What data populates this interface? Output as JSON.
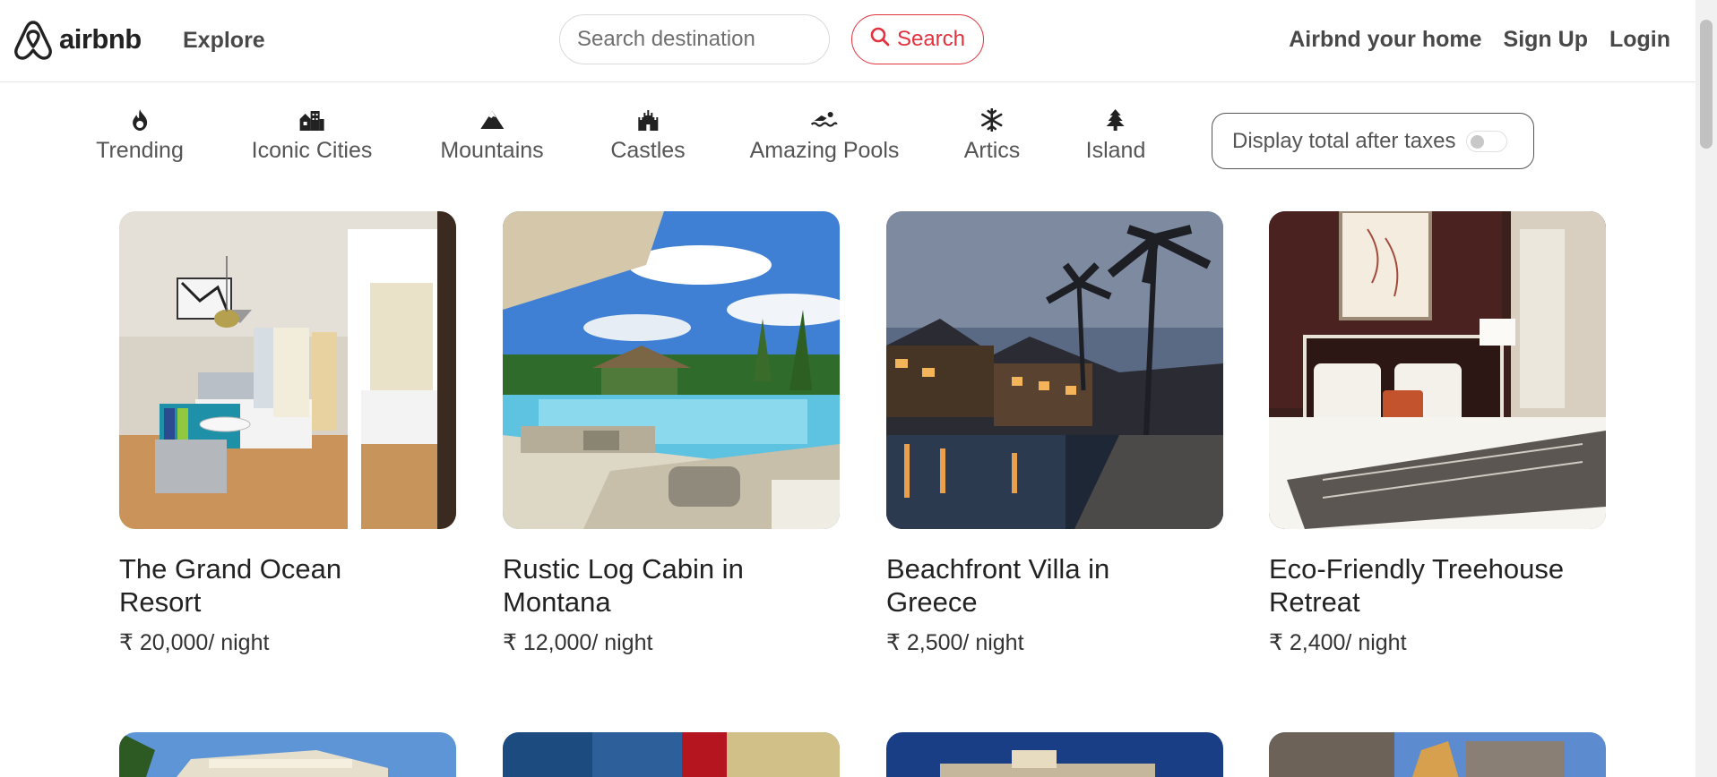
{
  "brand": {
    "name": "airbnb",
    "color": "#e2323d"
  },
  "navbar": {
    "explore": "Explore",
    "search_placeholder": "Search destination",
    "search_button": "Search",
    "links": [
      "Airbnd your home",
      "Sign Up",
      "Login"
    ]
  },
  "categories": [
    {
      "label": "Trending",
      "icon": "fire-icon"
    },
    {
      "label": "Iconic Cities",
      "icon": "city-icon"
    },
    {
      "label": "Mountains",
      "icon": "mountain-icon"
    },
    {
      "label": "Castles",
      "icon": "castle-icon"
    },
    {
      "label": "Amazing Pools",
      "icon": "swimmer-icon"
    },
    {
      "label": "Artics",
      "icon": "snowflake-icon"
    },
    {
      "label": "Island",
      "icon": "tree-icon"
    }
  ],
  "tax_toggle": {
    "label": "Display total after taxes",
    "enabled": false
  },
  "listings": [
    {
      "title": "The Grand Ocean Resort",
      "price": "₹ 20,000",
      "unit": "/ night",
      "image": "hotel-room-photo"
    },
    {
      "title": "Rustic Log Cabin in Montana",
      "price": "₹ 12,000",
      "unit": "/ night",
      "image": "resort-pool-photo"
    },
    {
      "title": "Beachfront Villa in Greece",
      "price": "₹ 2,500",
      "unit": "/ night",
      "image": "night-villa-pool-photo"
    },
    {
      "title": "Eco-Friendly Treehouse Retreat",
      "price": "₹ 2,400",
      "unit": "/ night",
      "image": "bedroom-photo"
    }
  ]
}
